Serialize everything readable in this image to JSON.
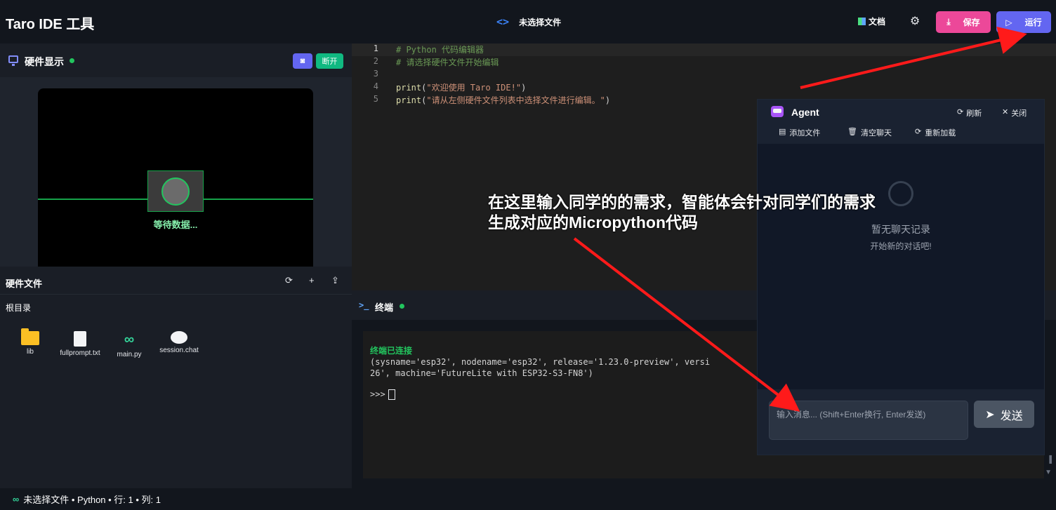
{
  "topbar": {
    "title": "Taro IDE 工具",
    "current_file": "未选择文件",
    "docs_label": "文档",
    "save_label": "保存",
    "run_label": "运行"
  },
  "hardware": {
    "title": "硬件显示",
    "disconnect_label": "断开",
    "waiting_text": "等待数据..."
  },
  "files": {
    "title": "硬件文件",
    "root_label": "根目录",
    "items": [
      {
        "name": "lib",
        "icon": "folder-icon"
      },
      {
        "name": "fullprompt.txt",
        "icon": "document-icon"
      },
      {
        "name": "main.py",
        "icon": "python-chain-icon"
      },
      {
        "name": "session.chat",
        "icon": "chat-bubble-icon"
      }
    ]
  },
  "editor": {
    "lines": [
      {
        "n": "1",
        "parts": [
          {
            "t": "# Python 代码编辑器",
            "c": "cmt"
          }
        ]
      },
      {
        "n": "2",
        "parts": [
          {
            "t": "# 请选择硬件文件开始编辑",
            "c": "cmt"
          }
        ]
      },
      {
        "n": "3",
        "parts": []
      },
      {
        "n": "4",
        "parts": [
          {
            "t": "print",
            "c": "fn"
          },
          {
            "t": "(",
            "c": "pun"
          },
          {
            "t": "\"欢迎使用 Taro IDE!\"",
            "c": "str"
          },
          {
            "t": ")",
            "c": "pun"
          }
        ]
      },
      {
        "n": "5",
        "parts": [
          {
            "t": "print",
            "c": "fn"
          },
          {
            "t": "(",
            "c": "pun"
          },
          {
            "t": "\"请从左侧硬件文件列表中选择文件进行编辑。\"",
            "c": "str"
          },
          {
            "t": ")",
            "c": "pun"
          }
        ]
      }
    ]
  },
  "terminal": {
    "title": "终端",
    "connected": "终端已连接",
    "line1": "(sysname='esp32', nodename='esp32', release='1.23.0-preview', versi",
    "line2": "26', machine='FutureLite with ESP32-S3-FN8')",
    "prompt": ">>>"
  },
  "agent": {
    "title": "Agent",
    "refresh": "刷新",
    "close": "关闭",
    "add_file": "添加文件",
    "clear_chat": "清空聊天",
    "reload": "重新加载",
    "empty_title": "暂无聊天记录",
    "empty_sub": "开始新的对话吧!",
    "input_placeholder": "输入消息... (Shift+Enter换行, Enter发送)",
    "send": "发送"
  },
  "annotation": {
    "line1": "在这里输入同学的的需求，智能体会针对同学们的需求",
    "line2": "生成对应的Micropython代码"
  },
  "status": {
    "text": "未选择文件 • Python • 行: 1 • 列: 1"
  },
  "colors": {
    "accent_indigo": "#6366f1",
    "save_pink": "#ec4899",
    "connected_green": "#22c55e",
    "arrow_red": "#ff1a1a"
  }
}
